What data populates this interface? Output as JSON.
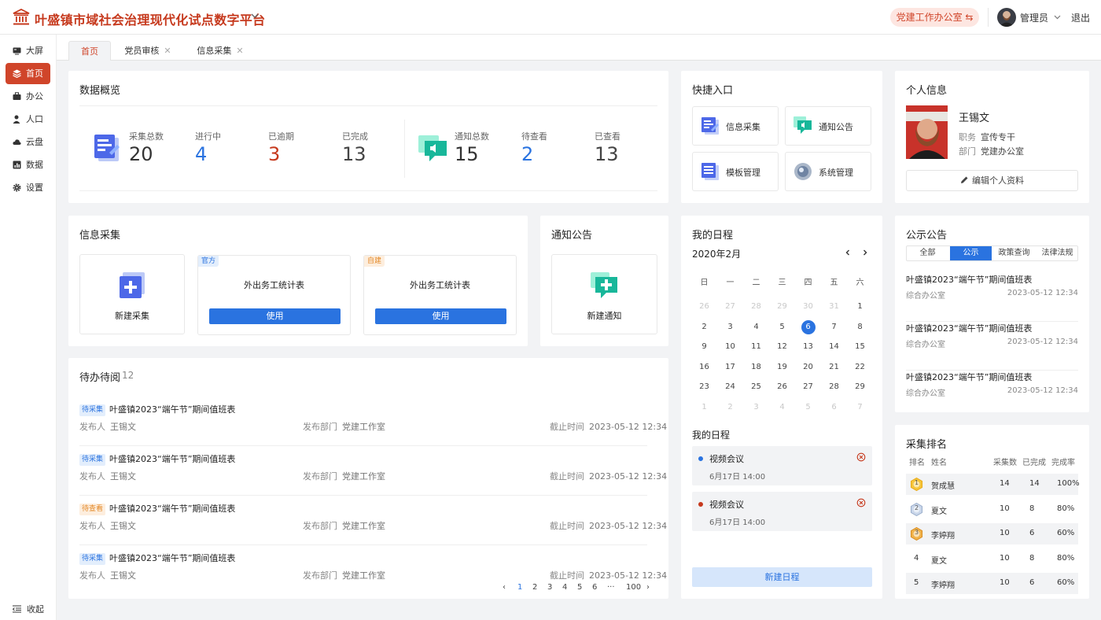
{
  "header": {
    "app_title": "叶盛镇市域社会治理现代化试点数字平台",
    "office_label": "党建工作办公室 ⇆",
    "user_name": "管理员",
    "logout": "退出"
  },
  "sidebar": {
    "items": [
      {
        "label": "大屏",
        "icon": "monitor-icon"
      },
      {
        "label": "首页",
        "icon": "layers-icon",
        "active": true
      },
      {
        "label": "办公",
        "icon": "briefcase-icon"
      },
      {
        "label": "人口",
        "icon": "person-icon"
      },
      {
        "label": "云盘",
        "icon": "cloud-icon"
      },
      {
        "label": "数据",
        "icon": "chart-icon"
      },
      {
        "label": "设置",
        "icon": "gear-icon"
      }
    ],
    "collapse": "收起"
  },
  "tabs": [
    {
      "label": "首页",
      "active": true
    },
    {
      "label": "党员审核",
      "close": "✕"
    },
    {
      "label": "信息采集",
      "close": "✕"
    }
  ],
  "overview": {
    "title": "数据概览",
    "collect": [
      {
        "label": "采集总数",
        "value": "20",
        "color": "#222222"
      },
      {
        "label": "进行中",
        "value": "4",
        "color": "#2a73e0"
      },
      {
        "label": "已逾期",
        "value": "3",
        "color": "#c6391d"
      },
      {
        "label": "已完成",
        "value": "13",
        "color": "#444444"
      }
    ],
    "notice": [
      {
        "label": "通知总数",
        "value": "15",
        "color": "#222222"
      },
      {
        "label": "待查看",
        "value": "2",
        "color": "#2a73e0"
      },
      {
        "label": "已查看",
        "value": "13",
        "color": "#444444"
      }
    ]
  },
  "quick": {
    "title": "快捷入口",
    "items": [
      {
        "label": "信息采集",
        "icon": "form-icon"
      },
      {
        "label": "通知公告",
        "icon": "chat-icon"
      },
      {
        "label": "模板管理",
        "icon": "template-icon"
      },
      {
        "label": "系统管理",
        "icon": "system-icon"
      }
    ]
  },
  "profile": {
    "title": "个人信息",
    "name": "王锡文",
    "position_label": "职务",
    "position": "宣传专干",
    "dept_label": "部门",
    "dept": "党建办公室",
    "edit": "编辑个人资料"
  },
  "collection": {
    "title": "信息采集",
    "new_label": "新建采集",
    "templates": [
      {
        "tag": "官方",
        "name": "外出务工统计表",
        "button": "使用"
      },
      {
        "tag": "自建",
        "name": "外出务工统计表",
        "button": "使用"
      }
    ]
  },
  "notice_card": {
    "title": "通知公告",
    "new_label": "新建通知"
  },
  "todo": {
    "title": "待办待阅",
    "count": "12",
    "publisher_label": "发布人",
    "dept_label": "发布部门",
    "deadline_label": "截止时间",
    "items": [
      {
        "badge": "待采集",
        "title": "叶盛镇2023“端午节”期间值班表",
        "publisher": "王锡文",
        "dept": "党建工作室",
        "deadline": "2023-05-12 12:34"
      },
      {
        "badge": "待采集",
        "title": "叶盛镇2023“端午节”期间值班表",
        "publisher": "王锡文",
        "dept": "党建工作室",
        "deadline": "2023-05-12 12:34"
      },
      {
        "badge": "待查看",
        "title": "叶盛镇2023“端午节”期间值班表",
        "publisher": "王锡文",
        "dept": "党建工作室",
        "deadline": "2023-05-12 12:34"
      },
      {
        "badge": "待采集",
        "title": "叶盛镇2023“端午节”期间值班表",
        "publisher": "王锡文",
        "dept": "党建工作室",
        "deadline": "2023-05-12 12:34"
      }
    ],
    "pagination": [
      "1",
      "2",
      "3",
      "4",
      "5",
      "6",
      "···",
      "100"
    ]
  },
  "calendar": {
    "title": "我的日程",
    "month": "2020年2月",
    "weekdays": [
      "日",
      "一",
      "二",
      "三",
      "四",
      "五",
      "六"
    ],
    "days": [
      [
        "26",
        "27",
        "28",
        "29",
        "30",
        "31",
        "1"
      ],
      [
        "2",
        "3",
        "4",
        "5",
        "6",
        "7",
        "8"
      ],
      [
        "9",
        "10",
        "11",
        "12",
        "13",
        "14",
        "15"
      ],
      [
        "16",
        "17",
        "18",
        "19",
        "20",
        "21",
        "22"
      ],
      [
        "23",
        "24",
        "25",
        "26",
        "27",
        "28",
        "29"
      ],
      [
        "1",
        "2",
        "3",
        "4",
        "5",
        "6",
        "7"
      ]
    ],
    "today": "6"
  },
  "schedule": {
    "title": "我的日程",
    "items": [
      {
        "title": "视频会议",
        "time": "6月17日 14:00",
        "color": "#2a73e0"
      },
      {
        "title": "视频会议",
        "time": "6月17日 14:00",
        "color": "#c6391d"
      }
    ],
    "new_button": "新建日程"
  },
  "announcements": {
    "title": "公示公告",
    "tabs": [
      "全部",
      "公示",
      "政策查询",
      "法律法规"
    ],
    "active_tab": "公示",
    "items": [
      {
        "title": "叶盛镇2023“端午节”期间值班表",
        "dept": "综合办公室",
        "time": "2023-05-12 12:34"
      },
      {
        "title": "叶盛镇2023“端午节”期间值班表",
        "dept": "综合办公室",
        "time": "2023-05-12 12:34"
      },
      {
        "title": "叶盛镇2023“端午节”期间值班表",
        "dept": "综合办公室",
        "time": "2023-05-12 12:34"
      }
    ]
  },
  "ranking": {
    "title": "采集排名",
    "headers": [
      "排名",
      "姓名",
      "采集数",
      "已完成",
      "完成率"
    ],
    "rows": [
      {
        "rank": "1",
        "name": "贺成慧",
        "count": "14",
        "done": "14",
        "rate": "100%"
      },
      {
        "rank": "2",
        "name": "夏文",
        "count": "10",
        "done": "8",
        "rate": "80%"
      },
      {
        "rank": "3",
        "name": "李婷翔",
        "count": "10",
        "done": "6",
        "rate": "60%"
      },
      {
        "rank": "4",
        "name": "夏文",
        "count": "10",
        "done": "8",
        "rate": "80%"
      },
      {
        "rank": "5",
        "name": "李婷翔",
        "count": "10",
        "done": "6",
        "rate": "60%"
      }
    ]
  },
  "colors": {
    "brand": "#c6391d",
    "accent": "#2a73e0"
  }
}
